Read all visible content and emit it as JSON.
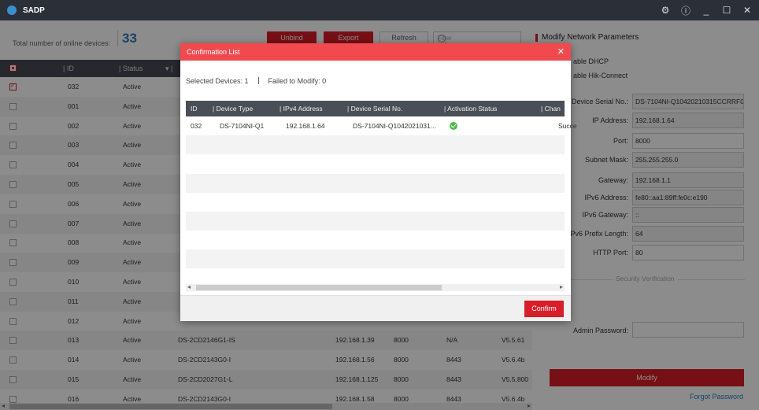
{
  "window": {
    "title": "SADP",
    "icons": [
      "gear-icon",
      "info-icon",
      "minimize-icon",
      "maximize-icon",
      "close-icon"
    ]
  },
  "toolbar": {
    "total_label": "Total number of online devices:",
    "total_count": "33",
    "unbind_label": "Unbind",
    "export_label": "Export",
    "refresh_label": "Refresh",
    "filter_placeholder": "Filter"
  },
  "device_table": {
    "columns": [
      "ID",
      "Status"
    ],
    "rows": [
      {
        "id": "032",
        "status": "Active",
        "type": "",
        "ip": "",
        "port": "",
        "extra": "",
        "version": "",
        "checked": true
      },
      {
        "id": "001",
        "status": "Active",
        "type": "",
        "ip": "",
        "port": "",
        "extra": "",
        "version": ""
      },
      {
        "id": "002",
        "status": "Active",
        "type": "",
        "ip": "",
        "port": "",
        "extra": "",
        "version": ""
      },
      {
        "id": "003",
        "status": "Active",
        "type": "",
        "ip": "",
        "port": "",
        "extra": "",
        "version": ""
      },
      {
        "id": "004",
        "status": "Active",
        "type": "",
        "ip": "",
        "port": "",
        "extra": "",
        "version": ""
      },
      {
        "id": "005",
        "status": "Active",
        "type": "",
        "ip": "",
        "port": "",
        "extra": "",
        "version": ""
      },
      {
        "id": "006",
        "status": "Active",
        "type": "",
        "ip": "",
        "port": "",
        "extra": "",
        "version": ""
      },
      {
        "id": "007",
        "status": "Active",
        "type": "",
        "ip": "",
        "port": "",
        "extra": "",
        "version": ""
      },
      {
        "id": "008",
        "status": "Active",
        "type": "",
        "ip": "",
        "port": "",
        "extra": "",
        "version": ""
      },
      {
        "id": "009",
        "status": "Active",
        "type": "",
        "ip": "",
        "port": "",
        "extra": "",
        "version": ""
      },
      {
        "id": "010",
        "status": "Active",
        "type": "",
        "ip": "",
        "port": "",
        "extra": "",
        "version": ""
      },
      {
        "id": "011",
        "status": "Active",
        "type": "",
        "ip": "",
        "port": "",
        "extra": "",
        "version": ""
      },
      {
        "id": "012",
        "status": "Active",
        "type": "",
        "ip": "",
        "port": "",
        "extra": "",
        "version": ""
      },
      {
        "id": "013",
        "status": "Active",
        "type": "DS-2CD2146G1-IS",
        "ip": "192.168.1.39",
        "port": "8000",
        "extra": "N/A",
        "version": "V5.5.61"
      },
      {
        "id": "014",
        "status": "Active",
        "type": "DS-2CD2143G0-I",
        "ip": "192.168.1.56",
        "port": "8000",
        "extra": "8443",
        "version": "V5.6.4b"
      },
      {
        "id": "015",
        "status": "Active",
        "type": "DS-2CD2027G1-L",
        "ip": "192.168.1.125",
        "port": "8000",
        "extra": "8443",
        "version": "V5.5.800"
      },
      {
        "id": "016",
        "status": "Active",
        "type": "DS-2CD2143G0-I",
        "ip": "192.168.1.58",
        "port": "8000",
        "extra": "8443",
        "version": "V5.6.4b"
      }
    ]
  },
  "right_panel": {
    "title": "Modify Network Parameters",
    "enable_dhcp": "able DHCP",
    "enable_hik": "able Hik-Connect",
    "fields": [
      {
        "label": "Device Serial No.:",
        "value": "DS-7104NI-Q10420210315CCRRF0"
      },
      {
        "label": "IP Address:",
        "value": "192.168.1.64"
      },
      {
        "label": "Port:",
        "value": "8000",
        "editable": true
      },
      {
        "label": "Subnet Mask:",
        "value": "255.255.255.0"
      },
      {
        "label": "Gateway:",
        "value": "192.168.1.1"
      },
      {
        "label": "IPv6 Address:",
        "value": "fe80::aa1:89ff:fe0c:e190"
      },
      {
        "label": "IPv6 Gateway:",
        "value": "::"
      },
      {
        "label": "IPv6 Prefix Length:",
        "value": "64"
      },
      {
        "label": "HTTP Port:",
        "value": "80",
        "editable": true
      }
    ],
    "security_title": "Security Verification",
    "admin_password_label": "Admin Password:",
    "modify_label": "Modify",
    "forgot_label": "Forgot Password"
  },
  "dialog": {
    "title": "Confirmation List",
    "selected_label": "Selected Devices: 1",
    "failed_label": "Failed to Modify: 0",
    "columns": [
      "ID",
      "Device Type",
      "IPv4 Address",
      "Device Serial No.",
      "Activation Status",
      "Chan"
    ],
    "rows": [
      {
        "id": "032",
        "type": "DS-7104NI-Q1",
        "ip": "192.168.1.64",
        "serial": "DS-7104NI-Q1042021031...",
        "activation": "ok",
        "result": "Succe"
      }
    ],
    "confirm_label": "Confirm",
    "colors": {
      "header": "#f04a4e",
      "confirm": "#d81e28",
      "active": "#4cbb4c"
    }
  }
}
